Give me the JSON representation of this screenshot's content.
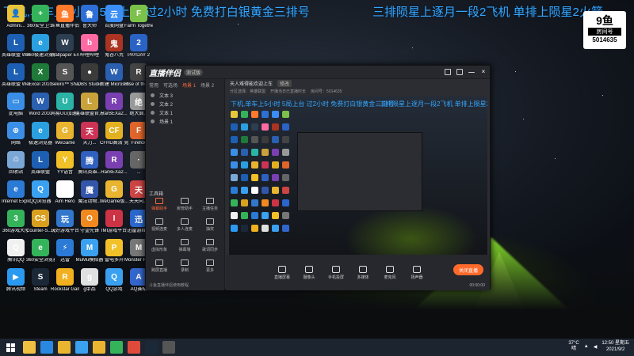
{
  "overlay": {
    "left_text": "下机,单车上5小时  5局上台   过2小时  免费打白银黄金三排号",
    "right_text": "三排陨星上逐月一段2飞机   单排上陨星2火箭"
  },
  "badge": {
    "top": "9鱼",
    "middle": "房间号",
    "room": "5014635"
  },
  "desktop_icons": [
    {
      "label": "Admini...",
      "color": "#e9c53a",
      "glyph": "👤"
    },
    {
      "label": "360安全卫士",
      "color": "#35b35a",
      "glyph": "+"
    },
    {
      "label": "斗鱼直播伴侣",
      "color": "#ff7a2b",
      "glyph": "鱼"
    },
    {
      "label": "鲁大师",
      "color": "#2d6fd6",
      "glyph": "鲁"
    },
    {
      "label": "百度网盘",
      "color": "#3a8ef5",
      "glyph": "云"
    },
    {
      "label": "Farm Together",
      "color": "#7cc14a",
      "glyph": "F"
    },
    {
      "label": "英雄联盟 WeGame版",
      "color": "#1d5fb3",
      "glyph": "L"
    },
    {
      "label": "360极速浏览器",
      "color": "#2aa0e0",
      "glyph": "e"
    },
    {
      "label": "Wallpaper Engine:...",
      "color": "#2c3e50",
      "glyph": "W"
    },
    {
      "label": "哔哩哔哩",
      "color": "#ff6aa2",
      "glyph": "b"
    },
    {
      "label": "鬼谷八荒",
      "color": "#aa3322",
      "glyph": "鬼"
    },
    {
      "label": "PAYDAY 2",
      "color": "#2a63c4",
      "glyph": "2"
    },
    {
      "label": "英雄联盟 WeGame版",
      "color": "#1d5fb3",
      "glyph": "L"
    },
    {
      "label": "Excel 2010",
      "color": "#1f7a3a",
      "glyph": "X"
    },
    {
      "label": "Sekiro™ Shadow...",
      "color": "#555555",
      "glyph": "S"
    },
    {
      "label": "OBS Studio",
      "color": "#3b3b3b",
      "glyph": "●"
    },
    {
      "label": "新建 Microsof...",
      "color": "#2b5fb0",
      "glyph": "W"
    },
    {
      "label": "Rise of the Tomb R...",
      "color": "#444444",
      "glyph": "R"
    },
    {
      "label": "此电脑",
      "color": "#3a8ee6",
      "glyph": "▭"
    },
    {
      "label": "Word 2010",
      "color": "#2b5fb0",
      "glyph": "W"
    },
    {
      "label": "网易UU加速器",
      "color": "#2bb3a6",
      "glyph": "U"
    },
    {
      "label": "英雄联盟官方 平台",
      "color": "#c9a23b",
      "glyph": "L"
    },
    {
      "label": "RarBEXa2...",
      "color": "#7a3fb0",
      "glyph": "R"
    },
    {
      "label": "绝大面...",
      "color": "#999999",
      "glyph": "绝"
    },
    {
      "label": "网络",
      "color": "#3a8ee6",
      "glyph": "⊕"
    },
    {
      "label": "极速浏览器",
      "color": "#2aa0e0",
      "glyph": "e"
    },
    {
      "label": "WeGame",
      "color": "#e9b530",
      "glyph": "G"
    },
    {
      "label": "天刀...",
      "color": "#cc3355",
      "glyph": "天"
    },
    {
      "label": "CFHD高清 竞技大区",
      "color": "#e3b020",
      "glyph": "CF"
    },
    {
      "label": "Firefox",
      "color": "#e0652b",
      "glyph": "F"
    },
    {
      "label": "回收站",
      "color": "#7aa7d6",
      "glyph": "♲"
    },
    {
      "label": "英雄联盟",
      "color": "#1d5fb3",
      "glyph": "L"
    },
    {
      "label": "YY语音",
      "color": "#f2c028",
      "glyph": "Y"
    },
    {
      "label": "腾讯英雄...",
      "color": "#3060c0",
      "glyph": "腾"
    },
    {
      "label": "RarBEXa2...",
      "color": "#7a3fb0",
      "glyph": "R"
    },
    {
      "label": "...",
      "color": "#666666",
      "glyph": "·"
    },
    {
      "label": "Internet Explorer",
      "color": "#2a7ad6",
      "glyph": "e"
    },
    {
      "label": "QQ浏览器",
      "color": "#3aa0f0",
      "glyph": "Q"
    },
    {
      "label": "Aim Hero",
      "color": "#ffffff",
      "glyph": "◎"
    },
    {
      "label": "魔法动物...",
      "color": "#3355aa",
      "glyph": "魔"
    },
    {
      "label": "WeGame版...",
      "color": "#e9b530",
      "glyph": "G"
    },
    {
      "label": "天天向上",
      "color": "#cc4444",
      "glyph": "天"
    },
    {
      "label": "360游戏大厅",
      "color": "#35b35a",
      "glyph": "3"
    },
    {
      "label": "Counter-S... Global Off...",
      "color": "#d9a020",
      "glyph": "CS"
    },
    {
      "label": "玩好游戏平台",
      "color": "#3377cc",
      "glyph": "玩"
    },
    {
      "label": "守望先锋",
      "color": "#f08a20",
      "glyph": "O"
    },
    {
      "label": "IMI游戏平台",
      "color": "#cc3344",
      "glyph": "I"
    },
    {
      "label": "迅雷游戏...",
      "color": "#2a66cc",
      "glyph": "迅"
    },
    {
      "label": "腾讯QQ",
      "color": "#f0f0f0",
      "glyph": "Q"
    },
    {
      "label": "360安全浏览器",
      "color": "#35b35a",
      "glyph": "e"
    },
    {
      "label": "迅雷",
      "color": "#2a7ad6",
      "glyph": "⚡"
    },
    {
      "label": "MuMu模拟器",
      "color": "#3aa0f0",
      "glyph": "M"
    },
    {
      "label": "雷电多开",
      "color": "#f2c028",
      "glyph": "P"
    },
    {
      "label": "Monster Hunter...",
      "color": "#777777",
      "glyph": "M"
    },
    {
      "label": "腾讯视频",
      "color": "#2a9af0",
      "glyph": "▶"
    },
    {
      "label": "Steam",
      "color": "#1b2838",
      "glyph": "S"
    },
    {
      "label": "Rockstar Games...",
      "color": "#f0b020",
      "glyph": "R"
    },
    {
      "label": "g单品",
      "color": "#e0e0e0",
      "glyph": "g"
    },
    {
      "label": "QQ游戏",
      "color": "#3aa0f0",
      "glyph": "Q"
    },
    {
      "label": "AQ赛帖",
      "color": "#3366cc",
      "glyph": "A"
    }
  ],
  "app": {
    "logo": "直播伴侣",
    "version": "测试版",
    "tabs": [
      "常用",
      "可选场",
      "场景 1",
      "场景 2"
    ],
    "active_tab_index": 2,
    "scenes": [
      "文本 3",
      "文本 2",
      "文本 1",
      "场景 1"
    ],
    "tools_header": "工具箱",
    "tools": [
      {
        "label": "弹幕助手"
      },
      {
        "label": "房管助手"
      },
      {
        "label": "主播任务"
      },
      {
        "label": "视频连麦"
      },
      {
        "label": "多人连麦"
      },
      {
        "label": "抽奖"
      },
      {
        "label": "虚拟形象"
      },
      {
        "label": "弹幕墙"
      },
      {
        "label": "歌词同步"
      },
      {
        "label": "跨屏直播"
      },
      {
        "label": "录制"
      },
      {
        "label": "更多"
      }
    ],
    "bottom_notice": "斗鱼直播伴侣使用教程",
    "room_title": "天人难得能欢迎上车",
    "room_tag": "修改",
    "room_sub_1": "分区选择：英雄联盟",
    "room_sub_2": "开播当日已直播时长",
    "room_sub_3": "房间号：5014635",
    "bottom_buttons": [
      {
        "label": "直播屏幕"
      },
      {
        "label": "摄像头"
      },
      {
        "label": "手机投屏"
      },
      {
        "label": "多媒体"
      },
      {
        "label": "麦克风"
      },
      {
        "label": "扬声器"
      }
    ],
    "live_button": "关闭直播",
    "live_time": "00:00:00"
  },
  "taskbar": {
    "items": [
      "explorer",
      "edge",
      "folder",
      "qq",
      "wegame",
      "360",
      "chrome",
      "steam",
      "obs"
    ],
    "weather_temp": "37°C",
    "weather_desc": "晴",
    "time": "12:50 星期五",
    "date": "2021/9/2"
  }
}
